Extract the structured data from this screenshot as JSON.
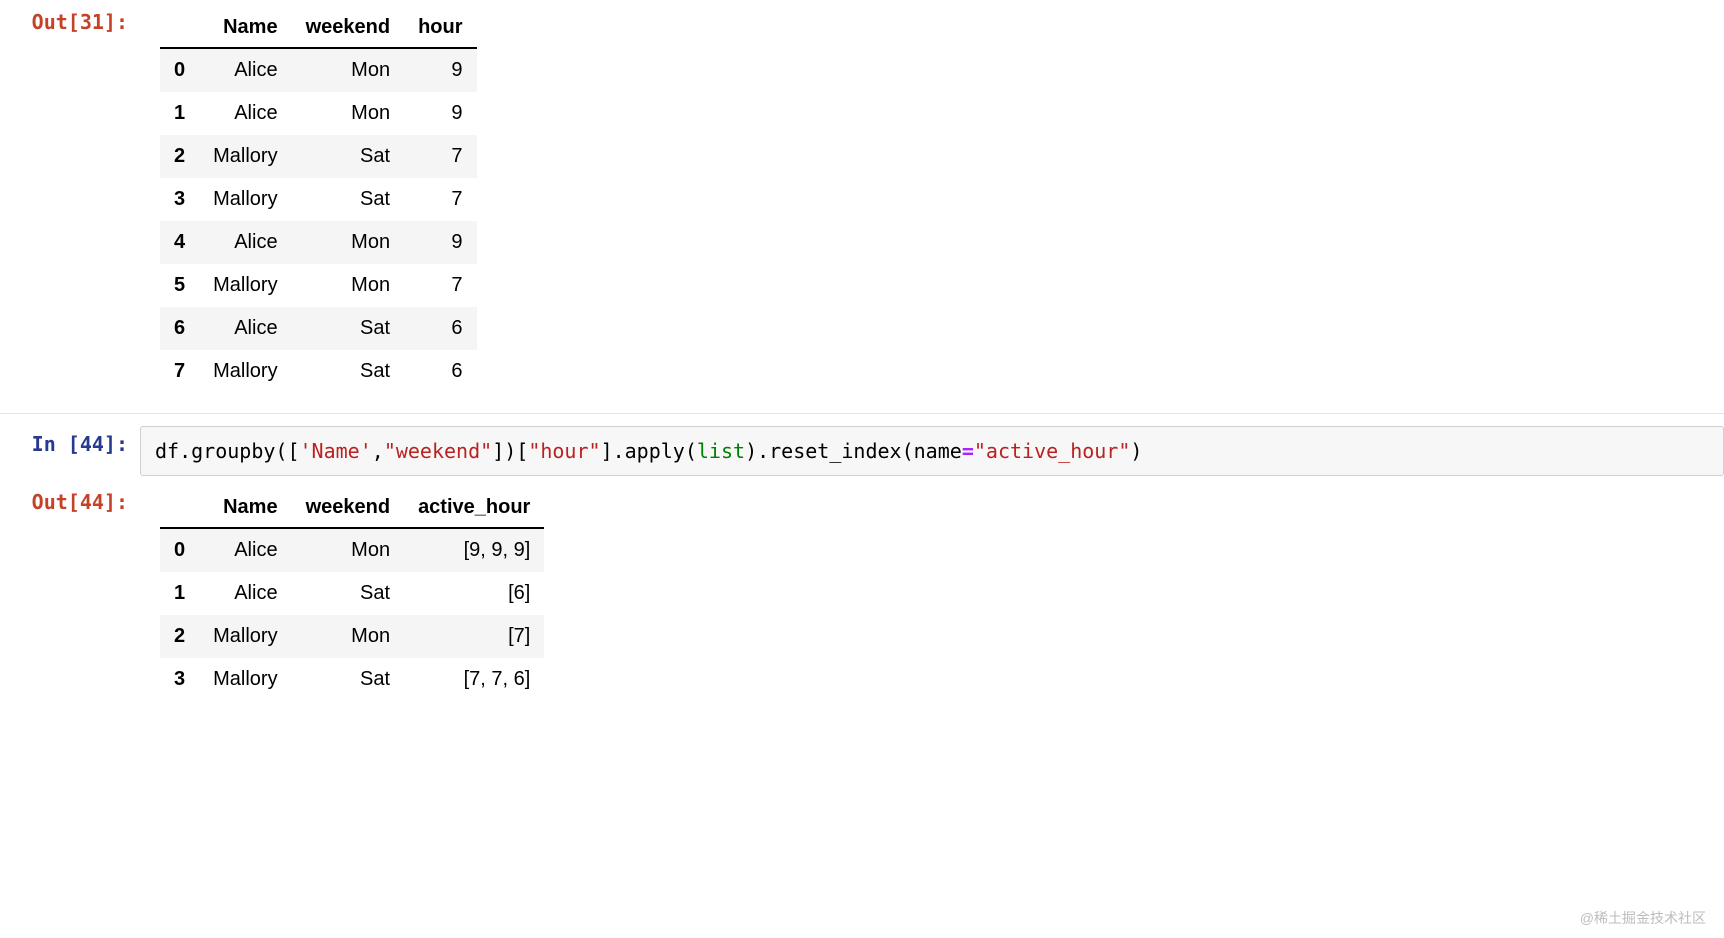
{
  "cells": {
    "out31": {
      "prompt": "Out[31]:",
      "table": {
        "columns": [
          "",
          "Name",
          "weekend",
          "hour"
        ],
        "rows": [
          {
            "idx": "0",
            "cells": [
              "Alice",
              "Mon",
              "9"
            ]
          },
          {
            "idx": "1",
            "cells": [
              "Alice",
              "Mon",
              "9"
            ]
          },
          {
            "idx": "2",
            "cells": [
              "Mallory",
              "Sat",
              "7"
            ]
          },
          {
            "idx": "3",
            "cells": [
              "Mallory",
              "Sat",
              "7"
            ]
          },
          {
            "idx": "4",
            "cells": [
              "Alice",
              "Mon",
              "9"
            ]
          },
          {
            "idx": "5",
            "cells": [
              "Mallory",
              "Mon",
              "7"
            ]
          },
          {
            "idx": "6",
            "cells": [
              "Alice",
              "Sat",
              "6"
            ]
          },
          {
            "idx": "7",
            "cells": [
              "Mallory",
              "Sat",
              "6"
            ]
          }
        ]
      }
    },
    "in44": {
      "prompt": "In [44]:",
      "code_tokens": [
        {
          "t": "df",
          "c": "tok-name"
        },
        {
          "t": ".groupby([",
          "c": "tok-name"
        },
        {
          "t": "'Name'",
          "c": "tok-str"
        },
        {
          "t": ",",
          "c": "tok-name"
        },
        {
          "t": "\"weekend\"",
          "c": "tok-str"
        },
        {
          "t": "])[",
          "c": "tok-name"
        },
        {
          "t": "\"hour\"",
          "c": "tok-str"
        },
        {
          "t": "].apply(",
          "c": "tok-name"
        },
        {
          "t": "list",
          "c": "tok-builtin"
        },
        {
          "t": ").reset_index(name",
          "c": "tok-name"
        },
        {
          "t": "=",
          "c": "tok-op"
        },
        {
          "t": "\"active_hour\"",
          "c": "tok-str"
        },
        {
          "t": ")",
          "c": "tok-name"
        }
      ]
    },
    "out44": {
      "prompt": "Out[44]:",
      "table": {
        "columns": [
          "",
          "Name",
          "weekend",
          "active_hour"
        ],
        "rows": [
          {
            "idx": "0",
            "cells": [
              "Alice",
              "Mon",
              "[9, 9, 9]"
            ]
          },
          {
            "idx": "1",
            "cells": [
              "Alice",
              "Sat",
              "[6]"
            ]
          },
          {
            "idx": "2",
            "cells": [
              "Mallory",
              "Mon",
              "[7]"
            ]
          },
          {
            "idx": "3",
            "cells": [
              "Mallory",
              "Sat",
              "[7, 7, 6]"
            ]
          }
        ]
      }
    }
  },
  "watermark": "@稀土掘金技术社区"
}
